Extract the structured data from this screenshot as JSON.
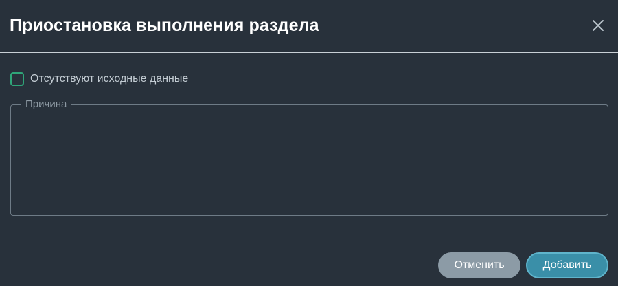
{
  "dialog": {
    "title": "Приостановка выполнения раздела",
    "close_icon": "close-icon"
  },
  "form": {
    "no_source_data_label": "Отсутствуют исходные данные",
    "no_source_data_checked": false,
    "reason_label": "Причина",
    "reason_value": ""
  },
  "footer": {
    "cancel_label": "Отменить",
    "add_label": "Добавить"
  },
  "colors": {
    "background": "#28313b",
    "checkbox_border": "#2fa679",
    "cancel_button": "#8c9ba6",
    "add_button": "#3a8fa8"
  }
}
